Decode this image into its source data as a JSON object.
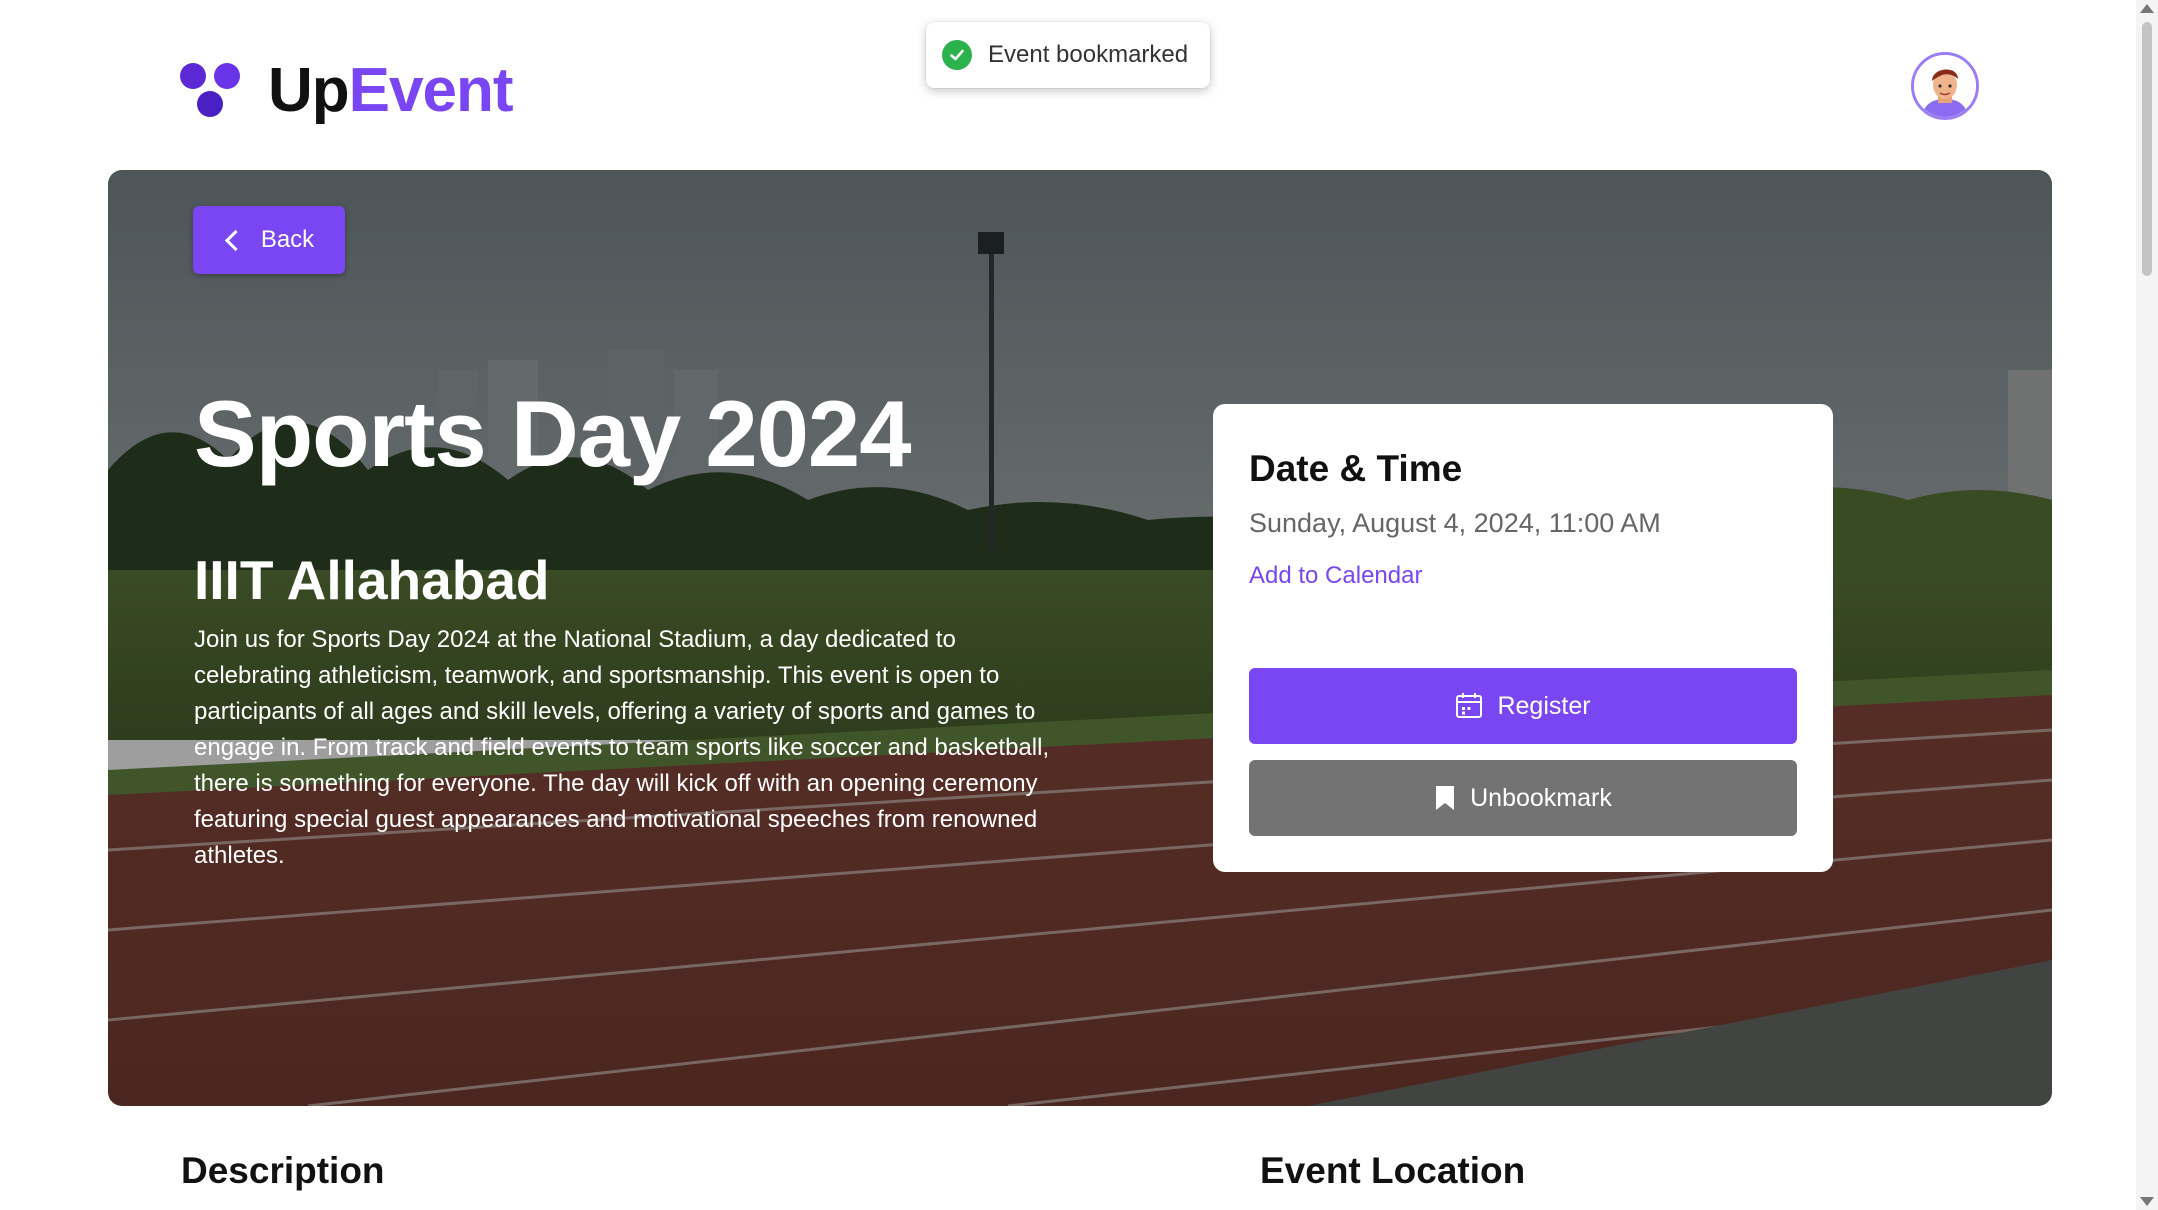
{
  "app": {
    "logo_part1": "Up",
    "logo_part2": "Event",
    "brand_color": "#7a45f2"
  },
  "toast": {
    "message": "Event bookmarked",
    "icon": "check-circle-icon",
    "color": "#2bb24c"
  },
  "header": {
    "avatar_icon": "user-avatar-icon"
  },
  "hero": {
    "back_label": "Back",
    "title": "Sports Day 2024",
    "organizer": "IIIT Allahabad",
    "description": "Join us for Sports Day 2024 at the National Stadium, a day dedicated to celebrating athleticism, teamwork, and sportsmanship. This event is open to participants of all ages and skill levels, offering a variety of sports and games to engage in. From track and field events to team sports like soccer and basketball, there is something for everyone. The day will kick off with an opening ceremony featuring special guest appearances and motivational speeches from renowned athletes."
  },
  "card": {
    "heading": "Date & Time",
    "datetime": "Sunday, August 4, 2024, 11:00 AM",
    "add_calendar": "Add to Calendar",
    "register_label": "Register",
    "register_icon": "calendar-icon",
    "unbookmark_label": "Unbookmark",
    "unbookmark_icon": "bookmark-icon"
  },
  "sections": {
    "description": "Description",
    "location": "Event Location"
  }
}
